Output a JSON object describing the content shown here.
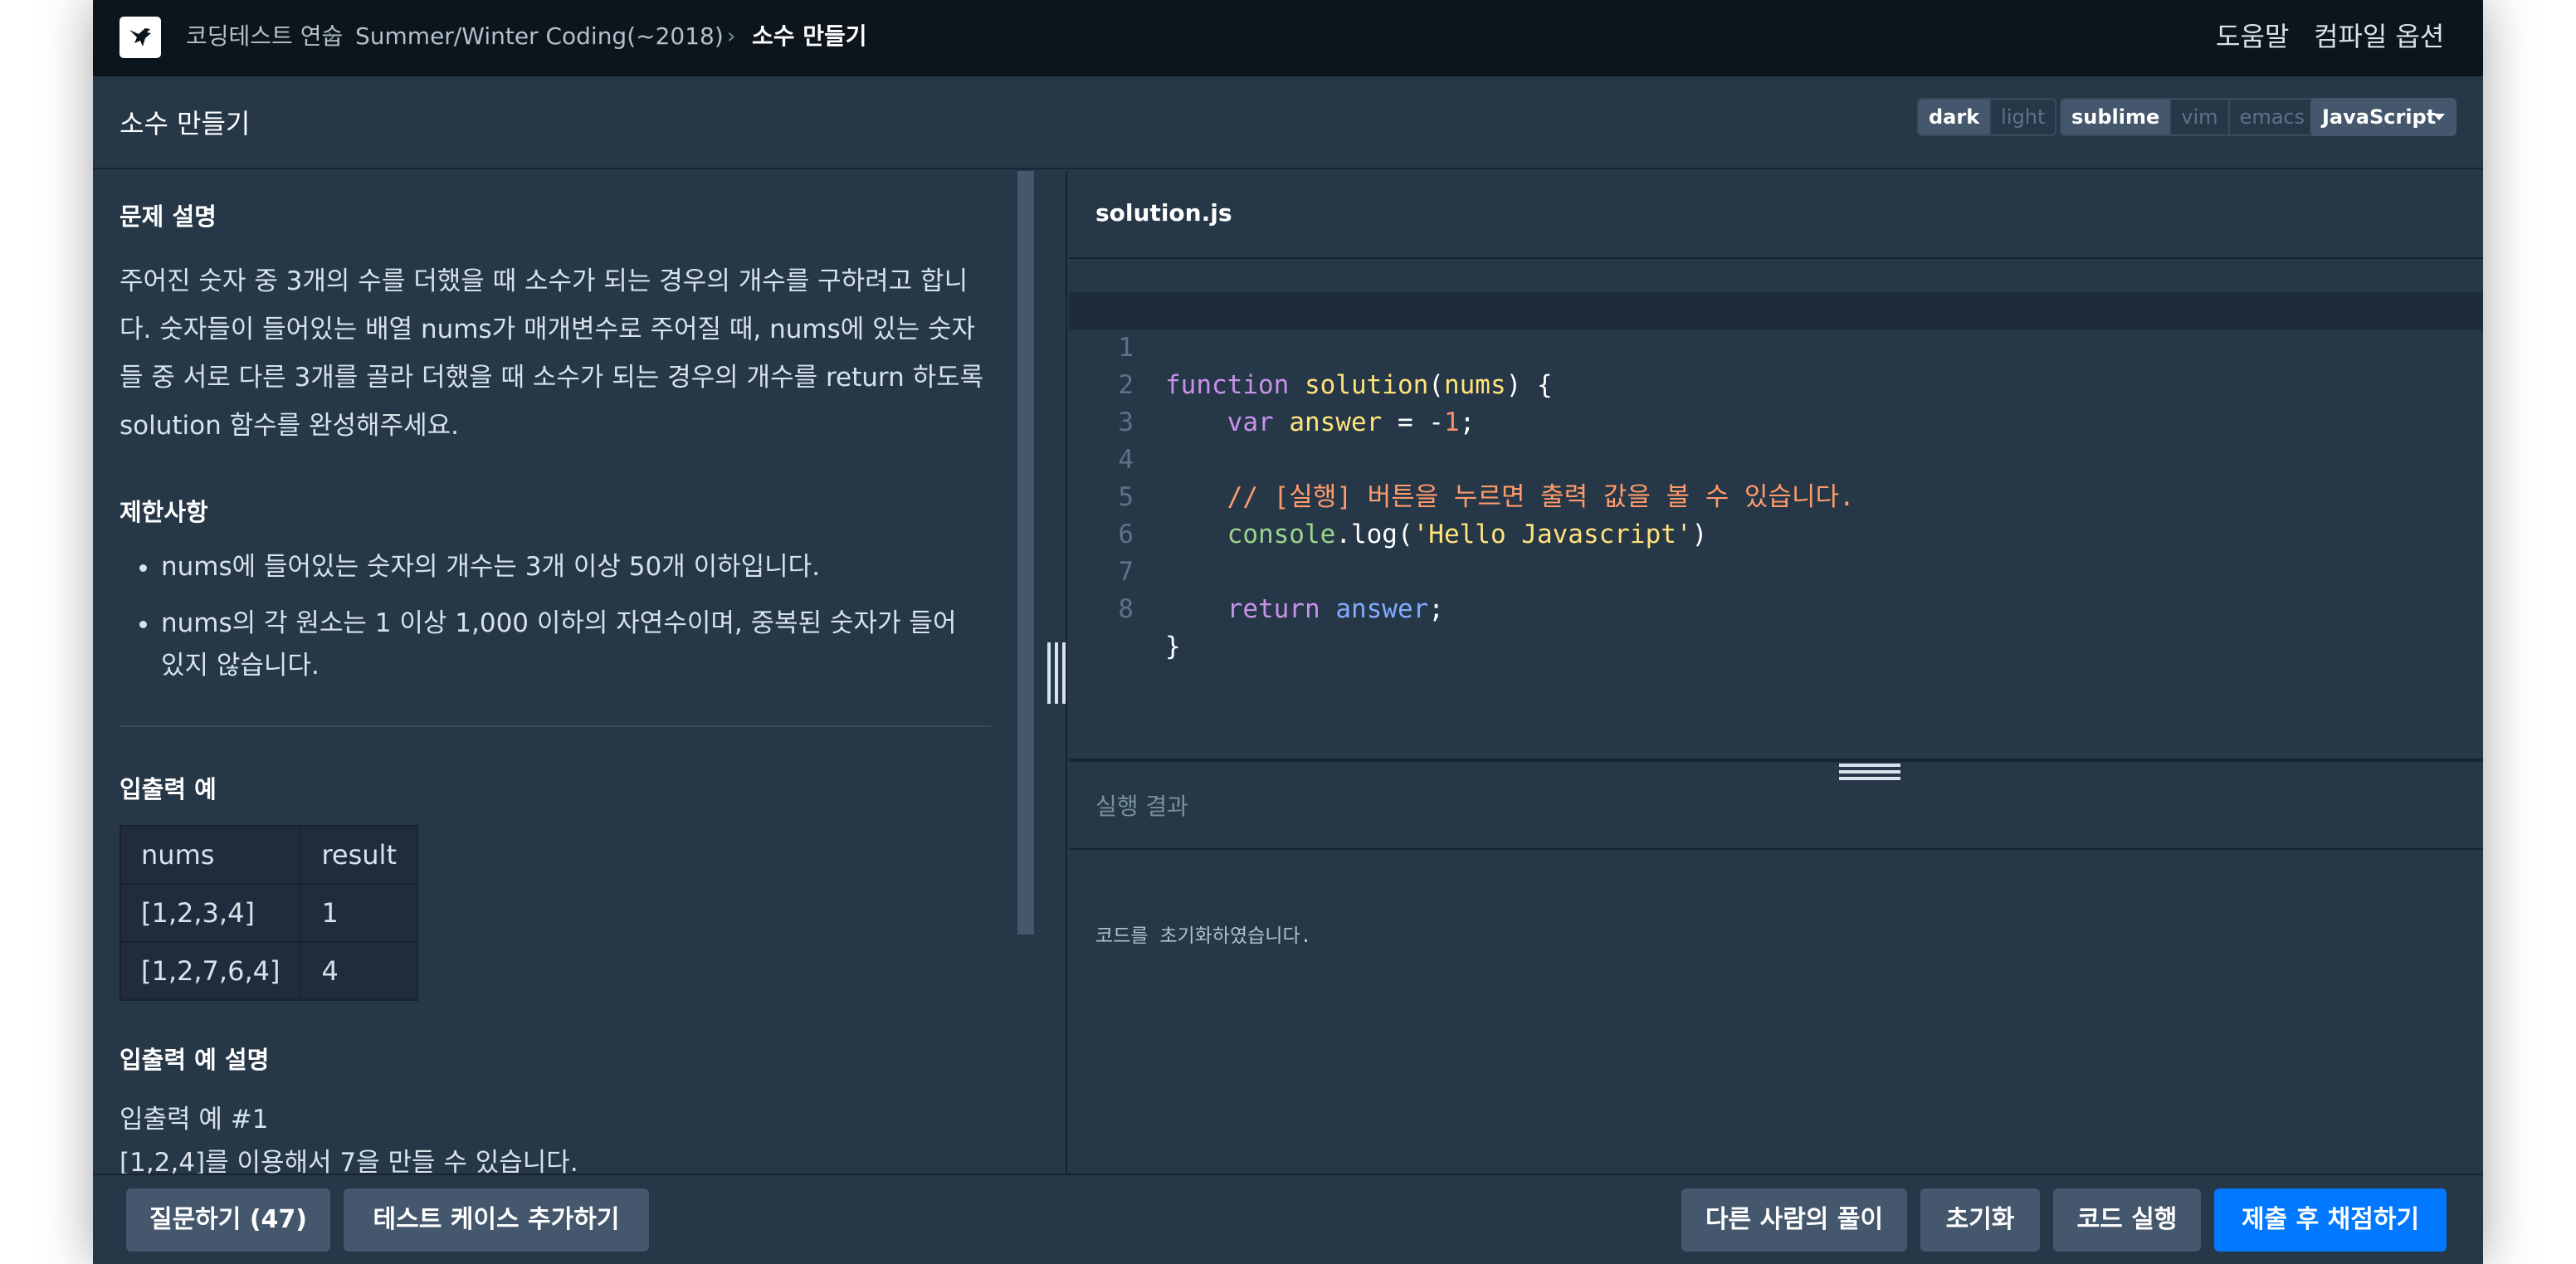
{
  "nav": {
    "breadcrumbs": [
      "코딩테스트 연습",
      "Summer/Winter Coding(~2018)",
      "소수 만들기"
    ],
    "help": "도움말",
    "compile_options": "컴파일 옵션"
  },
  "titlebar": {
    "title": "소수 만들기",
    "theme": {
      "options": [
        "dark",
        "light"
      ],
      "selected": "dark"
    },
    "keymap": {
      "options": [
        "sublime",
        "vim",
        "emacs"
      ],
      "selected": "sublime"
    },
    "language": "JavaScript"
  },
  "problem": {
    "section_desc": "문제 설명",
    "desc_lines": [
      "주어진 숫자 중 3개의 수를 더했을 때 소수가 되는 경우의 개수를 구하려고 합니",
      "다. 숫자들이 들어있는 배열 nums가 매개변수로 주어질 때, nums에 있는 숫자",
      "들 중 서로 다른 3개를 골라 더했을 때 소수가 되는 경우의 개수를 return 하도록",
      "solution 함수를 완성해주세요."
    ],
    "section_limits": "제한사항",
    "limits": [
      [
        "nums에 들어있는 숫자의 개수는 3개 이상 50개 이하입니다."
      ],
      [
        "nums의 각 원소는 1 이상 1,000 이하의 자연수이며, 중복된 숫자가 들어",
        "있지 않습니다."
      ]
    ],
    "section_io": "입출력 예",
    "table": {
      "headers": [
        "nums",
        "result"
      ],
      "rows": [
        [
          "[1,2,3,4]",
          "1"
        ],
        [
          "[1,2,7,6,4]",
          "4"
        ]
      ]
    },
    "section_io_desc": "입출력 예 설명",
    "io_desc_heading": "입출력 예 #1",
    "io_desc_line": "[1,2,4]를 이용해서 7을 만들 수 있습니다."
  },
  "editor": {
    "file_name": "solution.js",
    "line_numbers": [
      "1",
      "2",
      "3",
      "4",
      "5",
      "6",
      "7",
      "8"
    ],
    "code": {
      "l1_kw": "function",
      "l1_fn": "solution",
      "l1_open": "(",
      "l1_param": "nums",
      "l1_close": ") {",
      "l2_kw": "var",
      "l2_var": "answer",
      "l2_op": " = -",
      "l2_num": "1",
      "l2_end": ";",
      "l4_comment": "// [실행] 버튼을 누르면 출력 값을 볼 수 있습니다.",
      "l5_obj": "console",
      "l5_dot": ".log(",
      "l5_str": "'Hello Javascript'",
      "l5_end": ")",
      "l7_kw": "return",
      "l7_var": "answer",
      "l7_end": ";",
      "l8": "}"
    }
  },
  "output": {
    "title": "실행 결과",
    "message": "코드를 초기화하였습니다."
  },
  "bottombar": {
    "ask": "질문하기 (47)",
    "add_testcase": "테스트 케이스 추가하기",
    "others_solutions": "다른 사람의 풀이",
    "reset": "초기화",
    "run": "코드 실행",
    "submit": "제출 후 채점하기"
  },
  "colors": {
    "background": "#263747",
    "nav_background": "#0c151c",
    "primary_button": "#0078ff",
    "secondary_button": "#44576c"
  }
}
